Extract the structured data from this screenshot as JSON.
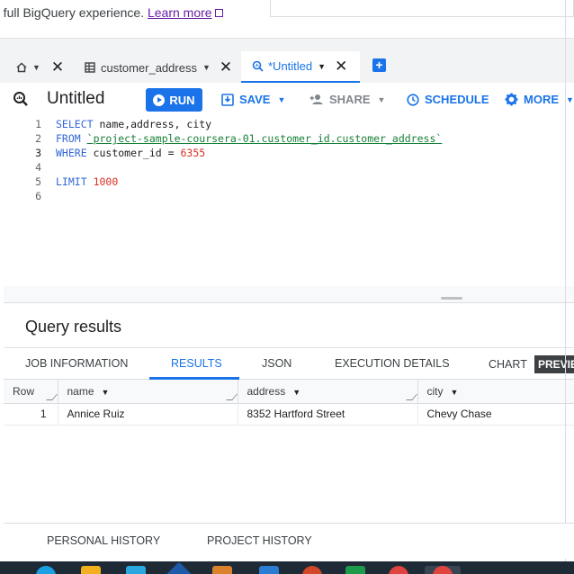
{
  "banner": {
    "text": "e full BigQuery experience.",
    "link": "Learn more"
  },
  "tabs": {
    "home_label": "",
    "tab2_label": "customer_address",
    "tab3_label": "*Untitled"
  },
  "toolbar": {
    "title": "Untitled",
    "run": "RUN",
    "save": "SAVE",
    "share": "SHARE",
    "schedule": "SCHEDULE",
    "more": "MORE"
  },
  "editor": {
    "line_numbers": [
      "1",
      "2",
      "3",
      "4",
      "5",
      "6"
    ],
    "l1_kw": "SELECT",
    "l1_rest": " name,address, city",
    "l2_kw": "FROM",
    "l2_str": "`project-sample-coursera-01.customer_id.customer_address`",
    "l3_kw": "WHERE",
    "l3_rest": " customer_id = ",
    "l3_num": "6355",
    "l5_kw": "LIMIT",
    "l5_num": "1000"
  },
  "results": {
    "title": "Query results",
    "tabs": [
      "JOB INFORMATION",
      "RESULTS",
      "JSON",
      "EXECUTION DETAILS",
      "CHART",
      "PREVIEW"
    ],
    "columns": [
      "Row",
      "name",
      "address",
      "city"
    ],
    "rows": [
      [
        "1",
        "Annice Ruiz",
        "8352 Hartford Street",
        "Chevy Chase"
      ]
    ]
  },
  "history": {
    "personal": "PERSONAL HISTORY",
    "project": "PROJECT HISTORY"
  },
  "colors": {
    "accent": "#1a73e8",
    "keyword": "#3367d6",
    "string": "#188038",
    "number": "#d93025"
  },
  "icons": [
    "home-icon",
    "table-icon",
    "query-icon",
    "add-tab-icon",
    "save-icon",
    "share-icon",
    "schedule-icon",
    "gear-icon"
  ]
}
